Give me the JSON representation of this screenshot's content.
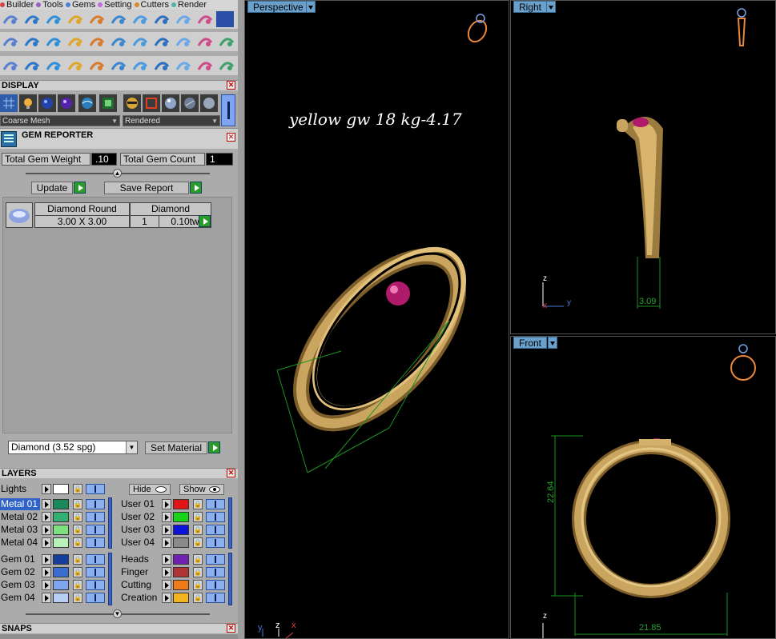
{
  "menubar": {
    "items": [
      {
        "label": "Builder",
        "dot": "#d24545"
      },
      {
        "label": "Tools",
        "dot": "#a05ad0"
      },
      {
        "label": "Gems",
        "dot": "#4a7fd4"
      },
      {
        "label": "Setting",
        "dot": "#c46adc"
      },
      {
        "label": "Cutters",
        "dot": "#d88a2c"
      },
      {
        "label": "Render",
        "dot": "#4db3a8"
      }
    ]
  },
  "toolbar": {
    "row1_icons": [
      "curve-icon",
      "spline-icon",
      "lock-pen-icon",
      "lock-tool-icon",
      "gem-cluster-icon",
      "sphere-icon",
      "ellipse-icon",
      "gem-burst-icon",
      "brush-icon",
      "cog-icon"
    ],
    "row2_icons": [
      "cube-icon",
      "diamond-icon",
      "plane-icon",
      "square-icon",
      "panel-icon",
      "fork-icon",
      "scissor-icon",
      "sphere-net-icon",
      "flower-icon",
      "film-icon",
      "molecule-icon"
    ],
    "row3_icons": [
      "blocks-icon",
      "arc-icon",
      "bend-icon",
      "bars-icon",
      "move-icon",
      "rotate-icon",
      "spray-icon",
      "link-icon",
      "mirror-icon",
      "cut-icon",
      "ring-icon"
    ]
  },
  "display": {
    "title": "DISPLAY",
    "mesh_select": "Coarse Mesh",
    "render_select": "Rendered"
  },
  "gem_reporter": {
    "title": "GEM REPORTER",
    "total_weight_label": "Total Gem Weight",
    "total_weight_value": ".10",
    "total_count_label": "Total Gem Count",
    "total_count_value": "1",
    "update_label": "Update",
    "save_label": "Save Report",
    "gem": {
      "shape": "Diamond Round",
      "size": "3.00 X 3.00",
      "material": "Diamond",
      "count": "1",
      "weight": "0.10tw"
    },
    "material_select": "Diamond     (3.52 spg)",
    "set_material_label": "Set Material"
  },
  "layers": {
    "title": "LAYERS",
    "lights_label": "Lights",
    "hide_label": "Hide",
    "show_label": "Show",
    "left": [
      {
        "name": "Metal 01",
        "color": "#1a8a5a",
        "selected": true
      },
      {
        "name": "Metal 02",
        "color": "#33b073",
        "selected": false
      },
      {
        "name": "Metal 03",
        "color": "#7fe07f",
        "selected": false
      },
      {
        "name": "Metal 04",
        "color": "#b8f2b8",
        "selected": false
      },
      {
        "name": "Gem 01",
        "color": "#133e9c",
        "selected": false
      },
      {
        "name": "Gem 02",
        "color": "#3c6ed0",
        "selected": false
      },
      {
        "name": "Gem 03",
        "color": "#7ea6f0",
        "selected": false
      },
      {
        "name": "Gem 04",
        "color": "#b7cff6",
        "selected": false
      }
    ],
    "right": [
      {
        "name": "User 01",
        "color": "#e01616"
      },
      {
        "name": "User 02",
        "color": "#18d418"
      },
      {
        "name": "User 03",
        "color": "#0c12d8"
      },
      {
        "name": "User 04",
        "color": "#8a8a8a"
      },
      {
        "name": "Heads",
        "color": "#6f21b2"
      },
      {
        "name": "Finger",
        "color": "#b03434"
      },
      {
        "name": "Cutting",
        "color": "#ee7a18"
      },
      {
        "name": "Creation",
        "color": "#f4b422"
      }
    ]
  },
  "snaps": {
    "title": "SNAPS"
  },
  "viewports": {
    "perspective": {
      "label": "Perspective",
      "caption": "yellow gw  18 kg-4.17"
    },
    "right": {
      "label": "Right",
      "dim": "3.09"
    },
    "front": {
      "label": "Front",
      "dim_h": "22.64",
      "dim_w": "21.85"
    }
  },
  "axes": {
    "x": "x",
    "y": "y",
    "z": "z"
  },
  "colors": {
    "gold": "#c9a560",
    "ruby": "#b01a6a",
    "dimension": "#29a32d",
    "icon_orange": "#e8873a"
  }
}
